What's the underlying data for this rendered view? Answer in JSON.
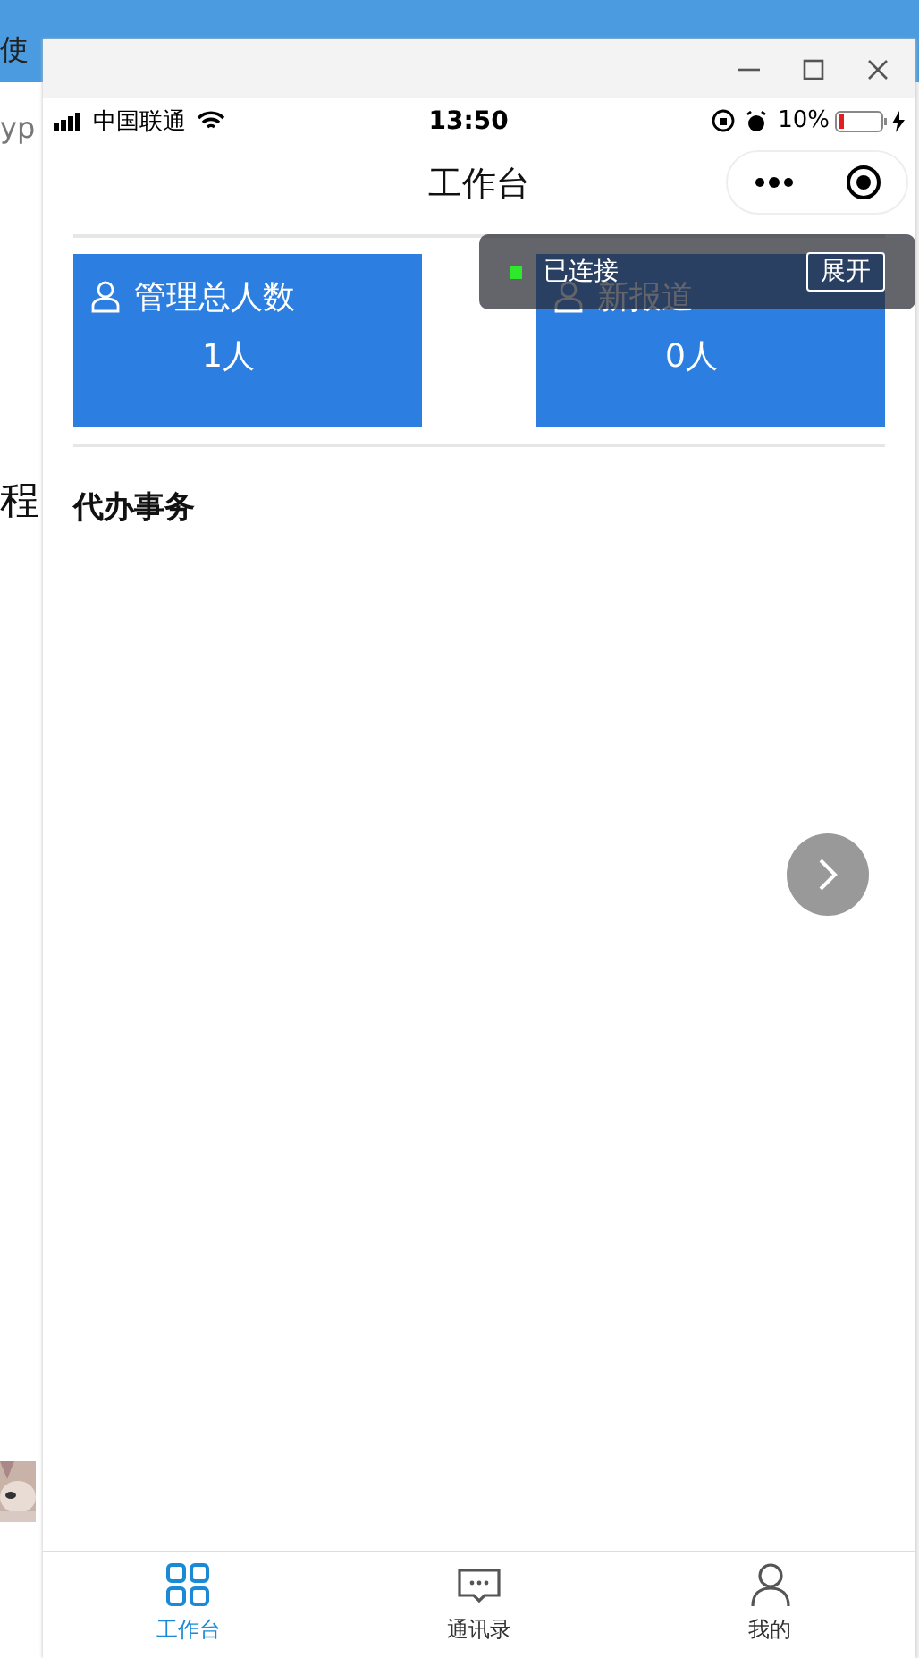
{
  "desktop": {
    "texts": [
      "使",
      "yp",
      "程"
    ]
  },
  "status_bar": {
    "carrier": "中国联通",
    "time": "13:50",
    "battery": "10%"
  },
  "nav": {
    "title": "工作台"
  },
  "stats": [
    {
      "label": "管理总人数",
      "value": "1人"
    },
    {
      "label": "新报道",
      "value": "0人"
    }
  ],
  "section": {
    "title": "代办事务"
  },
  "toast": {
    "status": "已连接",
    "button": "展开"
  },
  "tabs": [
    {
      "kind": "grid",
      "label": "工作台",
      "selected": true
    },
    {
      "kind": "chat",
      "label": "通讯录",
      "selected": false
    },
    {
      "kind": "person",
      "label": "我的",
      "selected": false
    }
  ]
}
